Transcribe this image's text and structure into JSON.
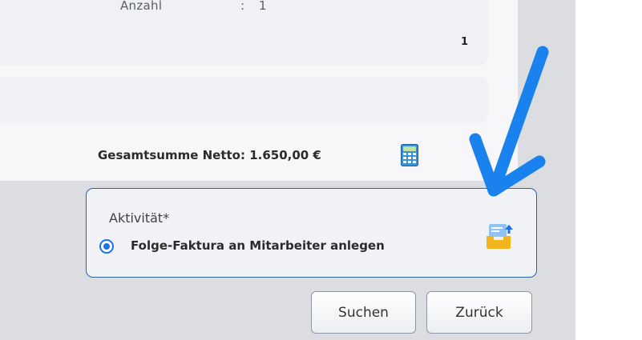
{
  "details": {
    "quantity_label": "Anzahl",
    "quantity_separator": ":",
    "quantity_value": "1",
    "row_number": "1"
  },
  "summary": {
    "total_label": "Gesamtsumme Netto: 1.650,00 €",
    "calculator_icon": "calculator-icon"
  },
  "activity": {
    "title": "Aktivität*",
    "option_label": "Folge-Faktura an Mitarbeiter anlegen",
    "option_selected": true,
    "tray_icon": "inbox-upload-icon"
  },
  "buttons": {
    "search_label": "Suchen",
    "back_label": "Zurück"
  },
  "colors": {
    "accent": "#1a73e8",
    "annotation_arrow": "#1a82ee",
    "box_border": "#2a5fa0"
  }
}
